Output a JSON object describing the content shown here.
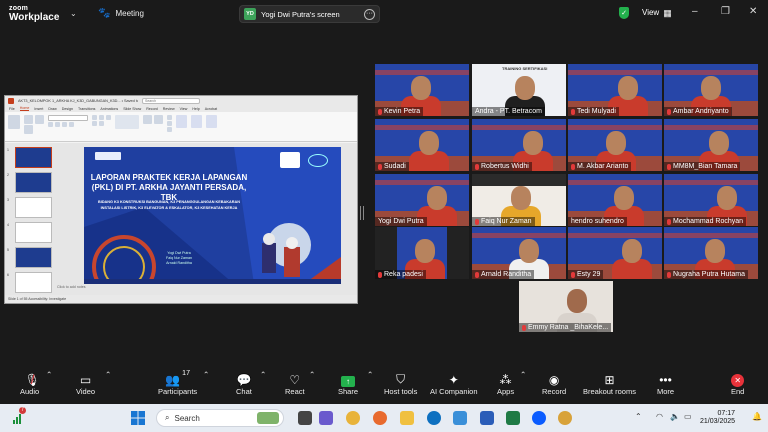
{
  "app": {
    "brand_top": "zoom",
    "brand_bottom": "Workplace",
    "meeting_label": "Meeting",
    "view_label": "View"
  },
  "share": {
    "initials": "YD",
    "label": "Yogi Dwi Putra's screen"
  },
  "slide_window": {
    "title": "AKT3_KELOMPOK 1_ARKHA KJ_K3D_GABUNGAN_K3D...  • Saved to this PC",
    "search_placeholder": "Search",
    "tabs": [
      "File",
      "Home",
      "Insert",
      "Draw",
      "Design",
      "Transitions",
      "Animations",
      "Slide Show",
      "Record",
      "Review",
      "View",
      "Help",
      "Acrobat"
    ],
    "slide_title": "LAPORAN PRAKTEK KERJA LAPANGAN (PKL) DI PT. ARKHA JAYANTI PERSADA, TBK",
    "slide_subtitle": "BIDANG K3 KONSTRUKSI BANGUNAN, K3 PENANGGULANGAN KEBAKARAN INSTALASI LISTRIK, K3 ELEVATOR & ESKALATOR, K3 KESEHATAN KERJA",
    "slide_names": "Yogi Dwi Putra\nFaiq Nur Zaman\nArnald Randitha",
    "notes_label": "Click to add notes",
    "status": "Slide 1 of 55   Accessibility: Investigate"
  },
  "participants": [
    {
      "name": "Kevin Petra",
      "muted": true
    },
    {
      "name": "Andra - PT. Betracom",
      "muted": false
    },
    {
      "name": "Tedi Mulyadi",
      "muted": true
    },
    {
      "name": "Ambar Andriyanto",
      "muted": true
    },
    {
      "name": "Sudadi",
      "muted": true
    },
    {
      "name": "Robertus Widhi",
      "muted": true
    },
    {
      "name": "M. Akbar Arianto",
      "muted": true
    },
    {
      "name": "MM8M_Bian Tamara",
      "muted": true
    },
    {
      "name": "Yogi Dwi Putra",
      "muted": false
    },
    {
      "name": "Faiq Nur Zaman",
      "muted": true
    },
    {
      "name": "hendro suhendro",
      "muted": false
    },
    {
      "name": "Mochammad Rochyan",
      "muted": true
    },
    {
      "name": "Reka padesi",
      "muted": true
    },
    {
      "name": "Arnald Randitha",
      "muted": true
    },
    {
      "name": "Esty 29",
      "muted": true
    },
    {
      "name": "Nugraha Putra Hutama",
      "muted": true
    },
    {
      "name": "Emmy Ratna _BihaKele...",
      "muted": true
    }
  ],
  "training_banner": "TRAINING SERTIFIKASI",
  "toolbar": {
    "audio": "Audio",
    "video": "Video",
    "participants": "Participants",
    "participants_count": "17",
    "chat": "Chat",
    "react": "React",
    "share": "Share",
    "host_tools": "Host tools",
    "ai_companion": "AI Companion",
    "apps": "Apps",
    "record": "Record",
    "breakout": "Breakout rooms",
    "more": "More",
    "end": "End"
  },
  "taskbar": {
    "search": "Search",
    "time": "07:17",
    "date": "21/03/2025",
    "badge": "7"
  },
  "colors": {
    "zoom_blue": "#0b5cff",
    "end_red": "#e8323a",
    "active_green": "#3fd08a"
  }
}
